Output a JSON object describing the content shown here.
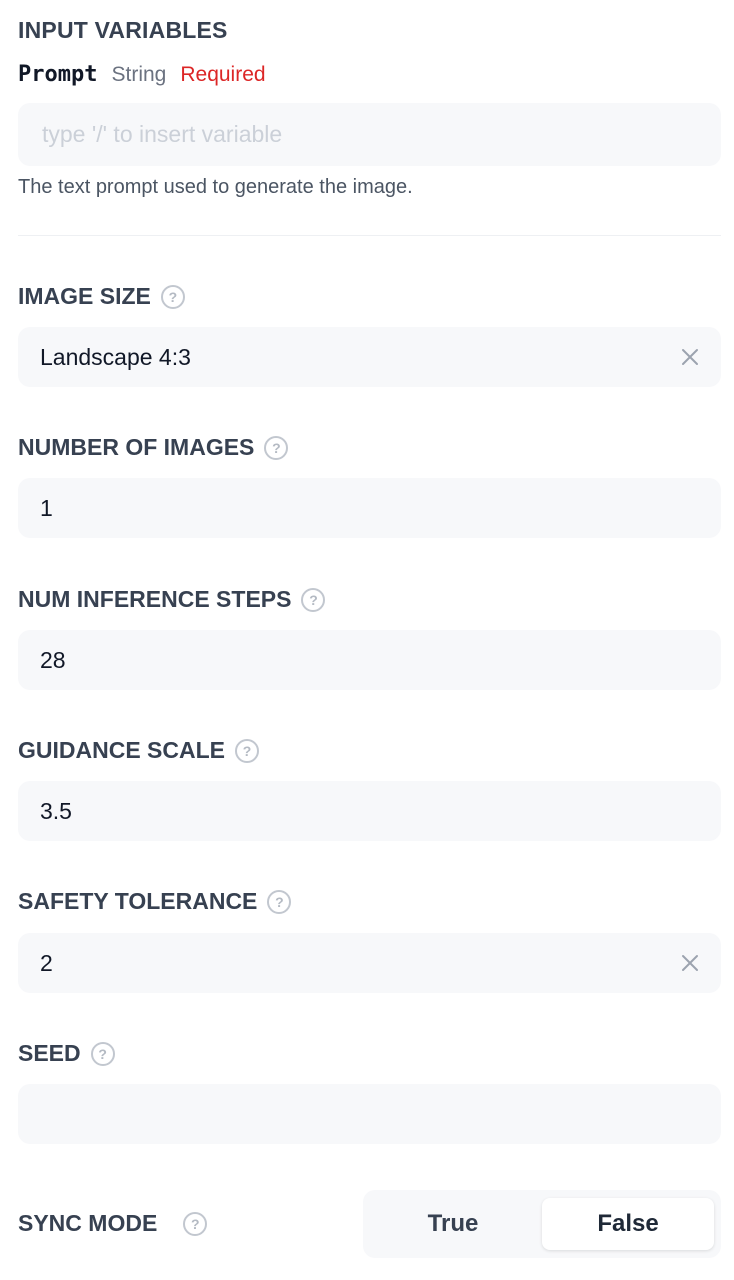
{
  "section": {
    "title": "INPUT VARIABLES"
  },
  "prompt_var": {
    "name": "Prompt",
    "type": "String",
    "required": "Required",
    "placeholder": "type '/' to insert variable",
    "helper": "The text prompt used to generate the image."
  },
  "fields": {
    "image_size": {
      "label": "IMAGE SIZE",
      "value": "Landscape 4:3"
    },
    "num_images": {
      "label": "NUMBER OF IMAGES",
      "value": "1"
    },
    "steps": {
      "label": "NUM INFERENCE STEPS",
      "value": "28"
    },
    "guidance": {
      "label": "GUIDANCE SCALE",
      "value": "3.5"
    },
    "safety": {
      "label": "SAFETY TOLERANCE",
      "value": "2"
    },
    "seed": {
      "label": "SEED",
      "value": ""
    }
  },
  "sync_mode": {
    "label": "SYNC MODE",
    "true_label": "True",
    "false_label": "False",
    "selected": "False"
  },
  "icons": {
    "help": "help-circle-icon",
    "clear": "close-icon"
  },
  "colors": {
    "required": "#dc2626",
    "field_bg": "#f7f8fa",
    "label": "#374151"
  }
}
